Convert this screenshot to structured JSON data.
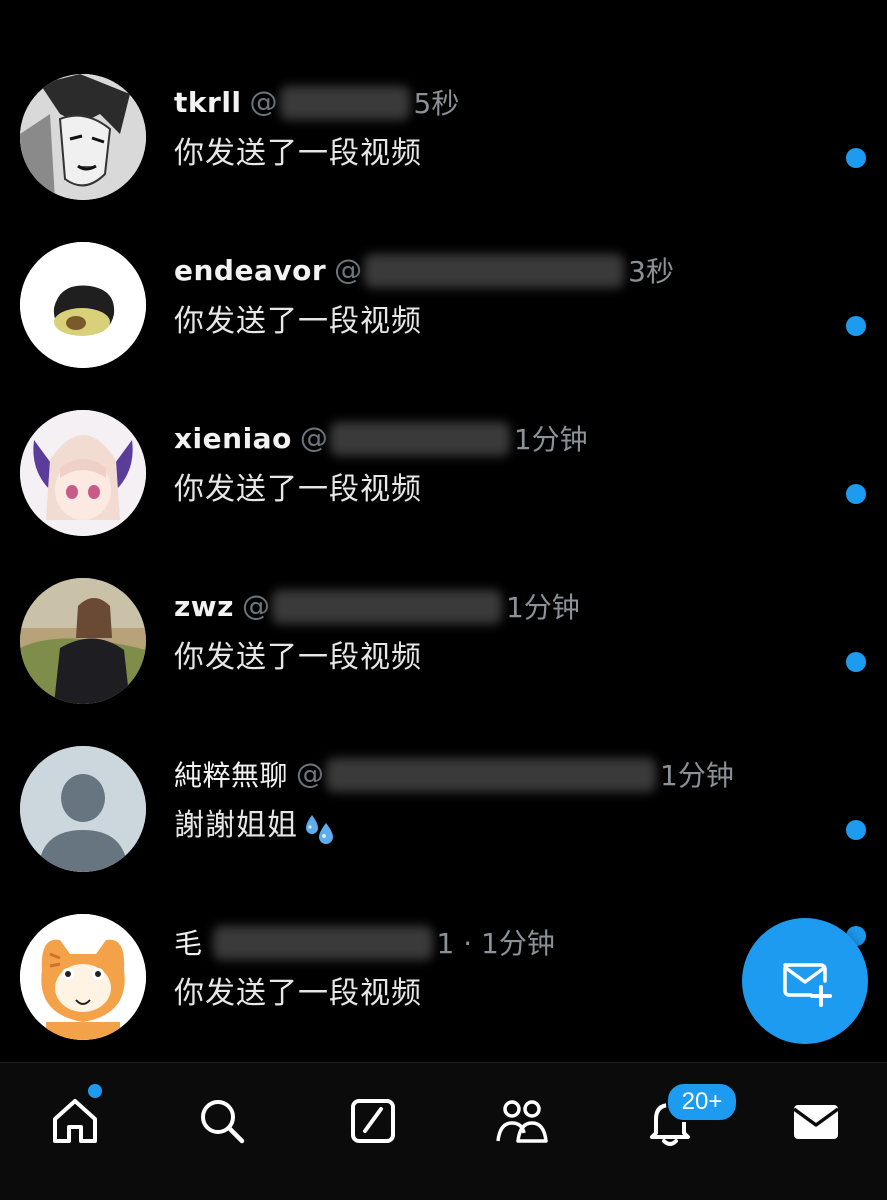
{
  "colors": {
    "background": "#000000",
    "accent": "#1d9bf0",
    "secondary_text": "#6e767d"
  },
  "conversations": [
    {
      "name": "tkrll",
      "handle_prefix": "@",
      "time": "5秒",
      "preview": "你发送了一段视频",
      "unread": true,
      "avatar": "manga-character-avatar"
    },
    {
      "name": "endeavor",
      "handle_prefix": "@",
      "time": "3秒",
      "preview": "你发送了一段视频",
      "unread": true,
      "avatar": "avocado-avatar"
    },
    {
      "name": "xieniao",
      "handle_prefix": "@",
      "time": "1分钟",
      "preview": "你发送了一段视频",
      "unread": true,
      "avatar": "anime-girl-avatar"
    },
    {
      "name": "zwz",
      "handle_prefix": "@",
      "time": "1分钟",
      "preview": "你发送了一段视频",
      "unread": true,
      "avatar": "photo-person-avatar"
    },
    {
      "name": "純粹無聊",
      "handle_prefix": "@",
      "time": "1分钟",
      "preview": "謝謝姐姐",
      "preview_emoji": "sweat-droplets-emoji",
      "unread": true,
      "avatar": "default-person-avatar"
    },
    {
      "name": "毛",
      "handle_prefix": "",
      "time": "1 · 1分钟",
      "preview": "你发送了一段视频",
      "unread": true,
      "avatar": "cartoon-cat-avatar"
    }
  ],
  "fab": {
    "icon": "new-message-icon"
  },
  "tabbar": {
    "items": [
      {
        "icon": "home-icon",
        "has_dot": true
      },
      {
        "icon": "search-icon"
      },
      {
        "icon": "compose-icon"
      },
      {
        "icon": "communities-icon"
      },
      {
        "icon": "notifications-icon",
        "badge": "20+"
      },
      {
        "icon": "messages-icon"
      }
    ]
  }
}
